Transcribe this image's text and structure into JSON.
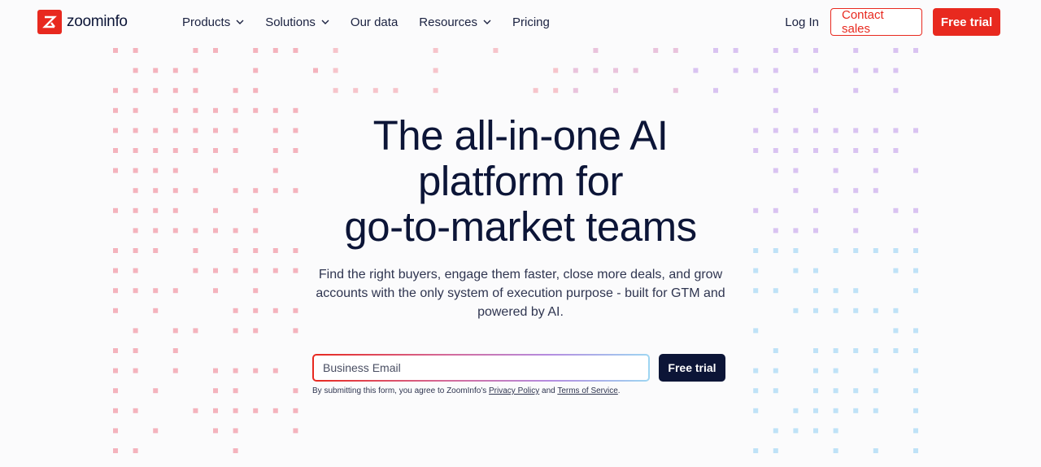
{
  "brand": {
    "name": "zoominfo",
    "accent": "#e8291f",
    "dark": "#0c1537"
  },
  "nav": {
    "items": [
      {
        "label": "Products",
        "has_dropdown": true
      },
      {
        "label": "Solutions",
        "has_dropdown": true
      },
      {
        "label": "Our data",
        "has_dropdown": false
      },
      {
        "label": "Resources",
        "has_dropdown": true
      },
      {
        "label": "Pricing",
        "has_dropdown": false
      }
    ],
    "login": "Log In",
    "contact_sales": "Contact sales",
    "free_trial": "Free trial"
  },
  "hero": {
    "headline": [
      "The all-in-one AI",
      "platform for",
      "go-to-market teams"
    ],
    "subheadline": "Find the right buyers, engage them faster, close more deals, and grow accounts with the only system of execution purpose - built for GTM and powered by AI.",
    "email_placeholder": "Business Email",
    "email_value": "",
    "cta": "Free trial",
    "legal_prefix": "By submitting this form, you agree to ZoomInfo's ",
    "privacy_link": "Privacy Policy",
    "legal_and": " and ",
    "terms_link": "Terms of Service",
    "legal_suffix": "."
  },
  "decor": {
    "left_dot_color": "#f4b3bd",
    "right_dot_color_top": "#d9c3f1",
    "right_dot_color_bottom": "#bfe2f7"
  }
}
